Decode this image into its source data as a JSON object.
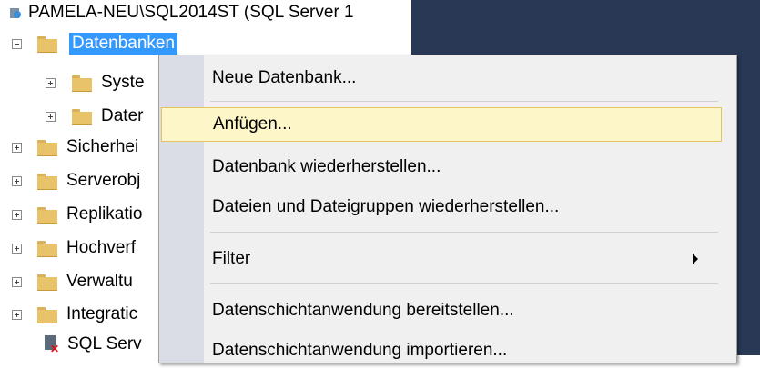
{
  "explorer": {
    "server_label": "PAMELA-NEU\\SQL2014ST (SQL Server 1",
    "nodes": [
      {
        "label": "Datenbanken"
      },
      {
        "label": "Syste"
      },
      {
        "label": "Dater"
      },
      {
        "label": "Sicherhei"
      },
      {
        "label": "Serverobj"
      },
      {
        "label": "Replikatio"
      },
      {
        "label": "Hochverf"
      },
      {
        "label": "Verwaltu"
      },
      {
        "label": "Integratic"
      },
      {
        "label": "SQL Serv"
      }
    ]
  },
  "context_menu": {
    "items": [
      {
        "label": "Neue Datenbank..."
      },
      {
        "label": "Anfügen..."
      },
      {
        "label": "Datenbank wiederherstellen..."
      },
      {
        "label": "Dateien und Dateigruppen wiederherstellen..."
      },
      {
        "label": "Filter"
      },
      {
        "label": "Datenschichtanwendung bereitstellen..."
      },
      {
        "label": "Datenschichtanwendung importieren..."
      }
    ]
  },
  "colors": {
    "selection": "#3399ff",
    "menu_hover_fill": "#fdf6c9",
    "menu_hover_border": "#e5c365",
    "dark_pane": "#293955"
  }
}
